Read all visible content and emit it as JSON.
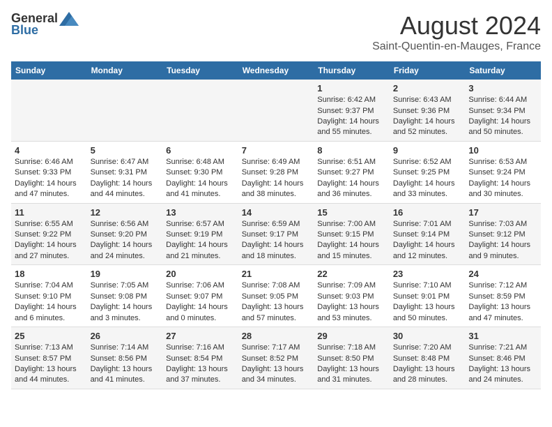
{
  "logo": {
    "general": "General",
    "blue": "Blue"
  },
  "header": {
    "title": "August 2024",
    "subtitle": "Saint-Quentin-en-Mauges, France"
  },
  "columns": [
    "Sunday",
    "Monday",
    "Tuesday",
    "Wednesday",
    "Thursday",
    "Friday",
    "Saturday"
  ],
  "weeks": [
    {
      "cells": [
        {
          "day": "",
          "text": ""
        },
        {
          "day": "",
          "text": ""
        },
        {
          "day": "",
          "text": ""
        },
        {
          "day": "",
          "text": ""
        },
        {
          "day": "1",
          "text": "Sunrise: 6:42 AM\nSunset: 9:37 PM\nDaylight: 14 hours\nand 55 minutes."
        },
        {
          "day": "2",
          "text": "Sunrise: 6:43 AM\nSunset: 9:36 PM\nDaylight: 14 hours\nand 52 minutes."
        },
        {
          "day": "3",
          "text": "Sunrise: 6:44 AM\nSunset: 9:34 PM\nDaylight: 14 hours\nand 50 minutes."
        }
      ]
    },
    {
      "cells": [
        {
          "day": "4",
          "text": "Sunrise: 6:46 AM\nSunset: 9:33 PM\nDaylight: 14 hours\nand 47 minutes."
        },
        {
          "day": "5",
          "text": "Sunrise: 6:47 AM\nSunset: 9:31 PM\nDaylight: 14 hours\nand 44 minutes."
        },
        {
          "day": "6",
          "text": "Sunrise: 6:48 AM\nSunset: 9:30 PM\nDaylight: 14 hours\nand 41 minutes."
        },
        {
          "day": "7",
          "text": "Sunrise: 6:49 AM\nSunset: 9:28 PM\nDaylight: 14 hours\nand 38 minutes."
        },
        {
          "day": "8",
          "text": "Sunrise: 6:51 AM\nSunset: 9:27 PM\nDaylight: 14 hours\nand 36 minutes."
        },
        {
          "day": "9",
          "text": "Sunrise: 6:52 AM\nSunset: 9:25 PM\nDaylight: 14 hours\nand 33 minutes."
        },
        {
          "day": "10",
          "text": "Sunrise: 6:53 AM\nSunset: 9:24 PM\nDaylight: 14 hours\nand 30 minutes."
        }
      ]
    },
    {
      "cells": [
        {
          "day": "11",
          "text": "Sunrise: 6:55 AM\nSunset: 9:22 PM\nDaylight: 14 hours\nand 27 minutes."
        },
        {
          "day": "12",
          "text": "Sunrise: 6:56 AM\nSunset: 9:20 PM\nDaylight: 14 hours\nand 24 minutes."
        },
        {
          "day": "13",
          "text": "Sunrise: 6:57 AM\nSunset: 9:19 PM\nDaylight: 14 hours\nand 21 minutes."
        },
        {
          "day": "14",
          "text": "Sunrise: 6:59 AM\nSunset: 9:17 PM\nDaylight: 14 hours\nand 18 minutes."
        },
        {
          "day": "15",
          "text": "Sunrise: 7:00 AM\nSunset: 9:15 PM\nDaylight: 14 hours\nand 15 minutes."
        },
        {
          "day": "16",
          "text": "Sunrise: 7:01 AM\nSunset: 9:14 PM\nDaylight: 14 hours\nand 12 minutes."
        },
        {
          "day": "17",
          "text": "Sunrise: 7:03 AM\nSunset: 9:12 PM\nDaylight: 14 hours\nand 9 minutes."
        }
      ]
    },
    {
      "cells": [
        {
          "day": "18",
          "text": "Sunrise: 7:04 AM\nSunset: 9:10 PM\nDaylight: 14 hours\nand 6 minutes."
        },
        {
          "day": "19",
          "text": "Sunrise: 7:05 AM\nSunset: 9:08 PM\nDaylight: 14 hours\nand 3 minutes."
        },
        {
          "day": "20",
          "text": "Sunrise: 7:06 AM\nSunset: 9:07 PM\nDaylight: 14 hours\nand 0 minutes."
        },
        {
          "day": "21",
          "text": "Sunrise: 7:08 AM\nSunset: 9:05 PM\nDaylight: 13 hours\nand 57 minutes."
        },
        {
          "day": "22",
          "text": "Sunrise: 7:09 AM\nSunset: 9:03 PM\nDaylight: 13 hours\nand 53 minutes."
        },
        {
          "day": "23",
          "text": "Sunrise: 7:10 AM\nSunset: 9:01 PM\nDaylight: 13 hours\nand 50 minutes."
        },
        {
          "day": "24",
          "text": "Sunrise: 7:12 AM\nSunset: 8:59 PM\nDaylight: 13 hours\nand 47 minutes."
        }
      ]
    },
    {
      "cells": [
        {
          "day": "25",
          "text": "Sunrise: 7:13 AM\nSunset: 8:57 PM\nDaylight: 13 hours\nand 44 minutes."
        },
        {
          "day": "26",
          "text": "Sunrise: 7:14 AM\nSunset: 8:56 PM\nDaylight: 13 hours\nand 41 minutes."
        },
        {
          "day": "27",
          "text": "Sunrise: 7:16 AM\nSunset: 8:54 PM\nDaylight: 13 hours\nand 37 minutes."
        },
        {
          "day": "28",
          "text": "Sunrise: 7:17 AM\nSunset: 8:52 PM\nDaylight: 13 hours\nand 34 minutes."
        },
        {
          "day": "29",
          "text": "Sunrise: 7:18 AM\nSunset: 8:50 PM\nDaylight: 13 hours\nand 31 minutes."
        },
        {
          "day": "30",
          "text": "Sunrise: 7:20 AM\nSunset: 8:48 PM\nDaylight: 13 hours\nand 28 minutes."
        },
        {
          "day": "31",
          "text": "Sunrise: 7:21 AM\nSunset: 8:46 PM\nDaylight: 13 hours\nand 24 minutes."
        }
      ]
    }
  ]
}
